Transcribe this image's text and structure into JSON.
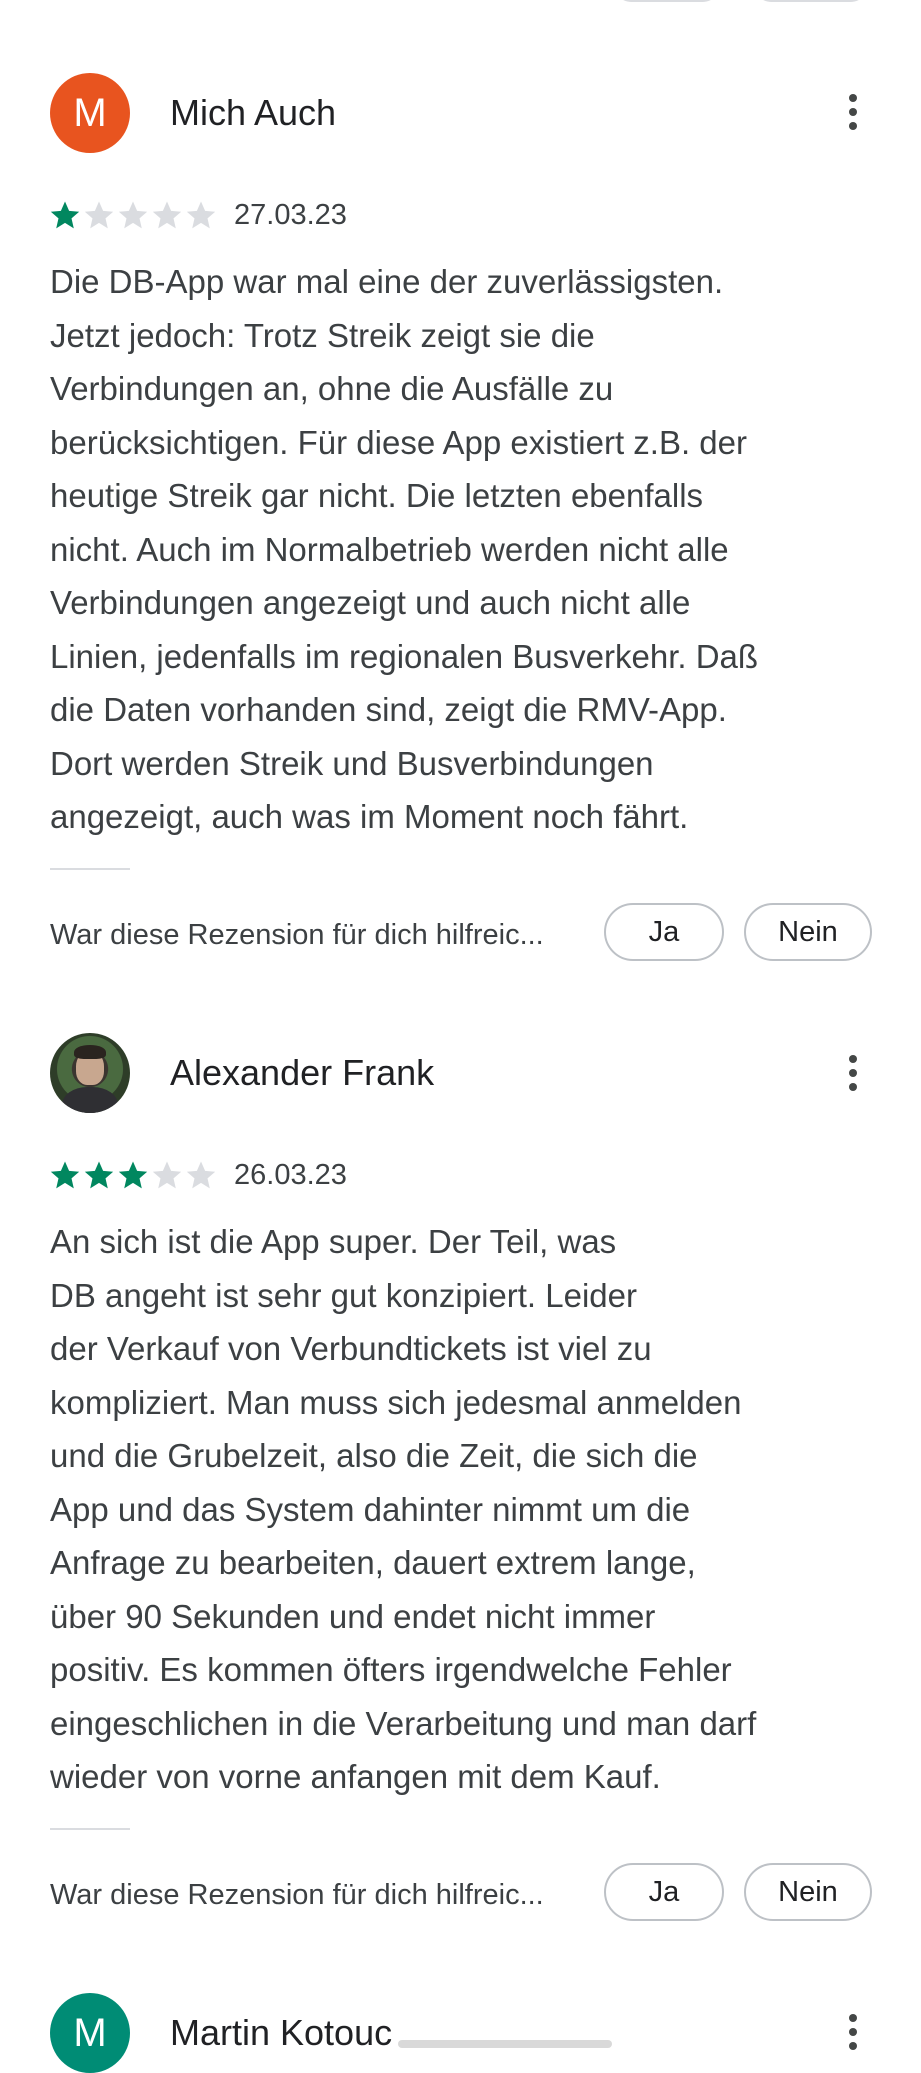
{
  "colors": {
    "accent_green": "#01875f",
    "star_empty": "#dadce0",
    "avatar_orange": "#e8541f",
    "avatar_teal": "#008c75"
  },
  "icons": {
    "menu": "more-vert-icon",
    "star": "star-icon"
  },
  "reviews": [
    {
      "author": "Mich Auch",
      "avatar_letter": "M",
      "avatar_color": "#e8541f",
      "rating": 1,
      "rating_max": 5,
      "date": "27.03.23",
      "text": "Die DB-App war mal eine der zuverlässigsten.\nJetzt jedoch: Trotz Streik zeigt sie die\nVerbindungen an, ohne die Ausfälle zu\nberücksichtigen. Für diese App existiert z.B. der\nheutige Streik gar nicht. Die letzten ebenfalls\nnicht. Auch im Normalbetrieb werden nicht alle\nVerbindungen angezeigt und auch nicht alle\nLinien, jedenfalls im regionalen Busverkehr. Daß\ndie Daten vorhanden sind, zeigt die RMV-App.\nDort werden Streik und Busverbindungen\nangezeigt, auch was im Moment noch fährt.",
      "helpful_question": "War diese Rezension für dich hilfreic...",
      "yes_label": "Ja",
      "no_label": "Nein"
    },
    {
      "author": "Alexander Frank",
      "avatar_letter": "",
      "avatar_color": "#4a6a40",
      "rating": 3,
      "rating_max": 5,
      "date": "26.03.23",
      "text": "An sich ist die App super. Der Teil, was\nDB angeht ist sehr gut konzipiert. Leider\nder Verkauf von Verbundtickets ist viel zu\nkompliziert. Man muss sich jedesmal anmelden\nund die Grubelzeit, also die Zeit, die sich die\nApp und das System dahinter nimmt um die\nAnfrage zu bearbeiten, dauert extrem lange,\nüber 90 Sekunden und endet nicht immer\npositiv. Es kommen öfters irgendwelche Fehler\neingeschlichen in die Verarbeitung und man darf\nwieder von vorne anfangen mit dem Kauf.",
      "helpful_question": "War diese Rezension für dich hilfreic...",
      "yes_label": "Ja",
      "no_label": "Nein"
    },
    {
      "author": "Martin Kotouc",
      "avatar_letter": "M",
      "avatar_color": "#008c75"
    }
  ]
}
